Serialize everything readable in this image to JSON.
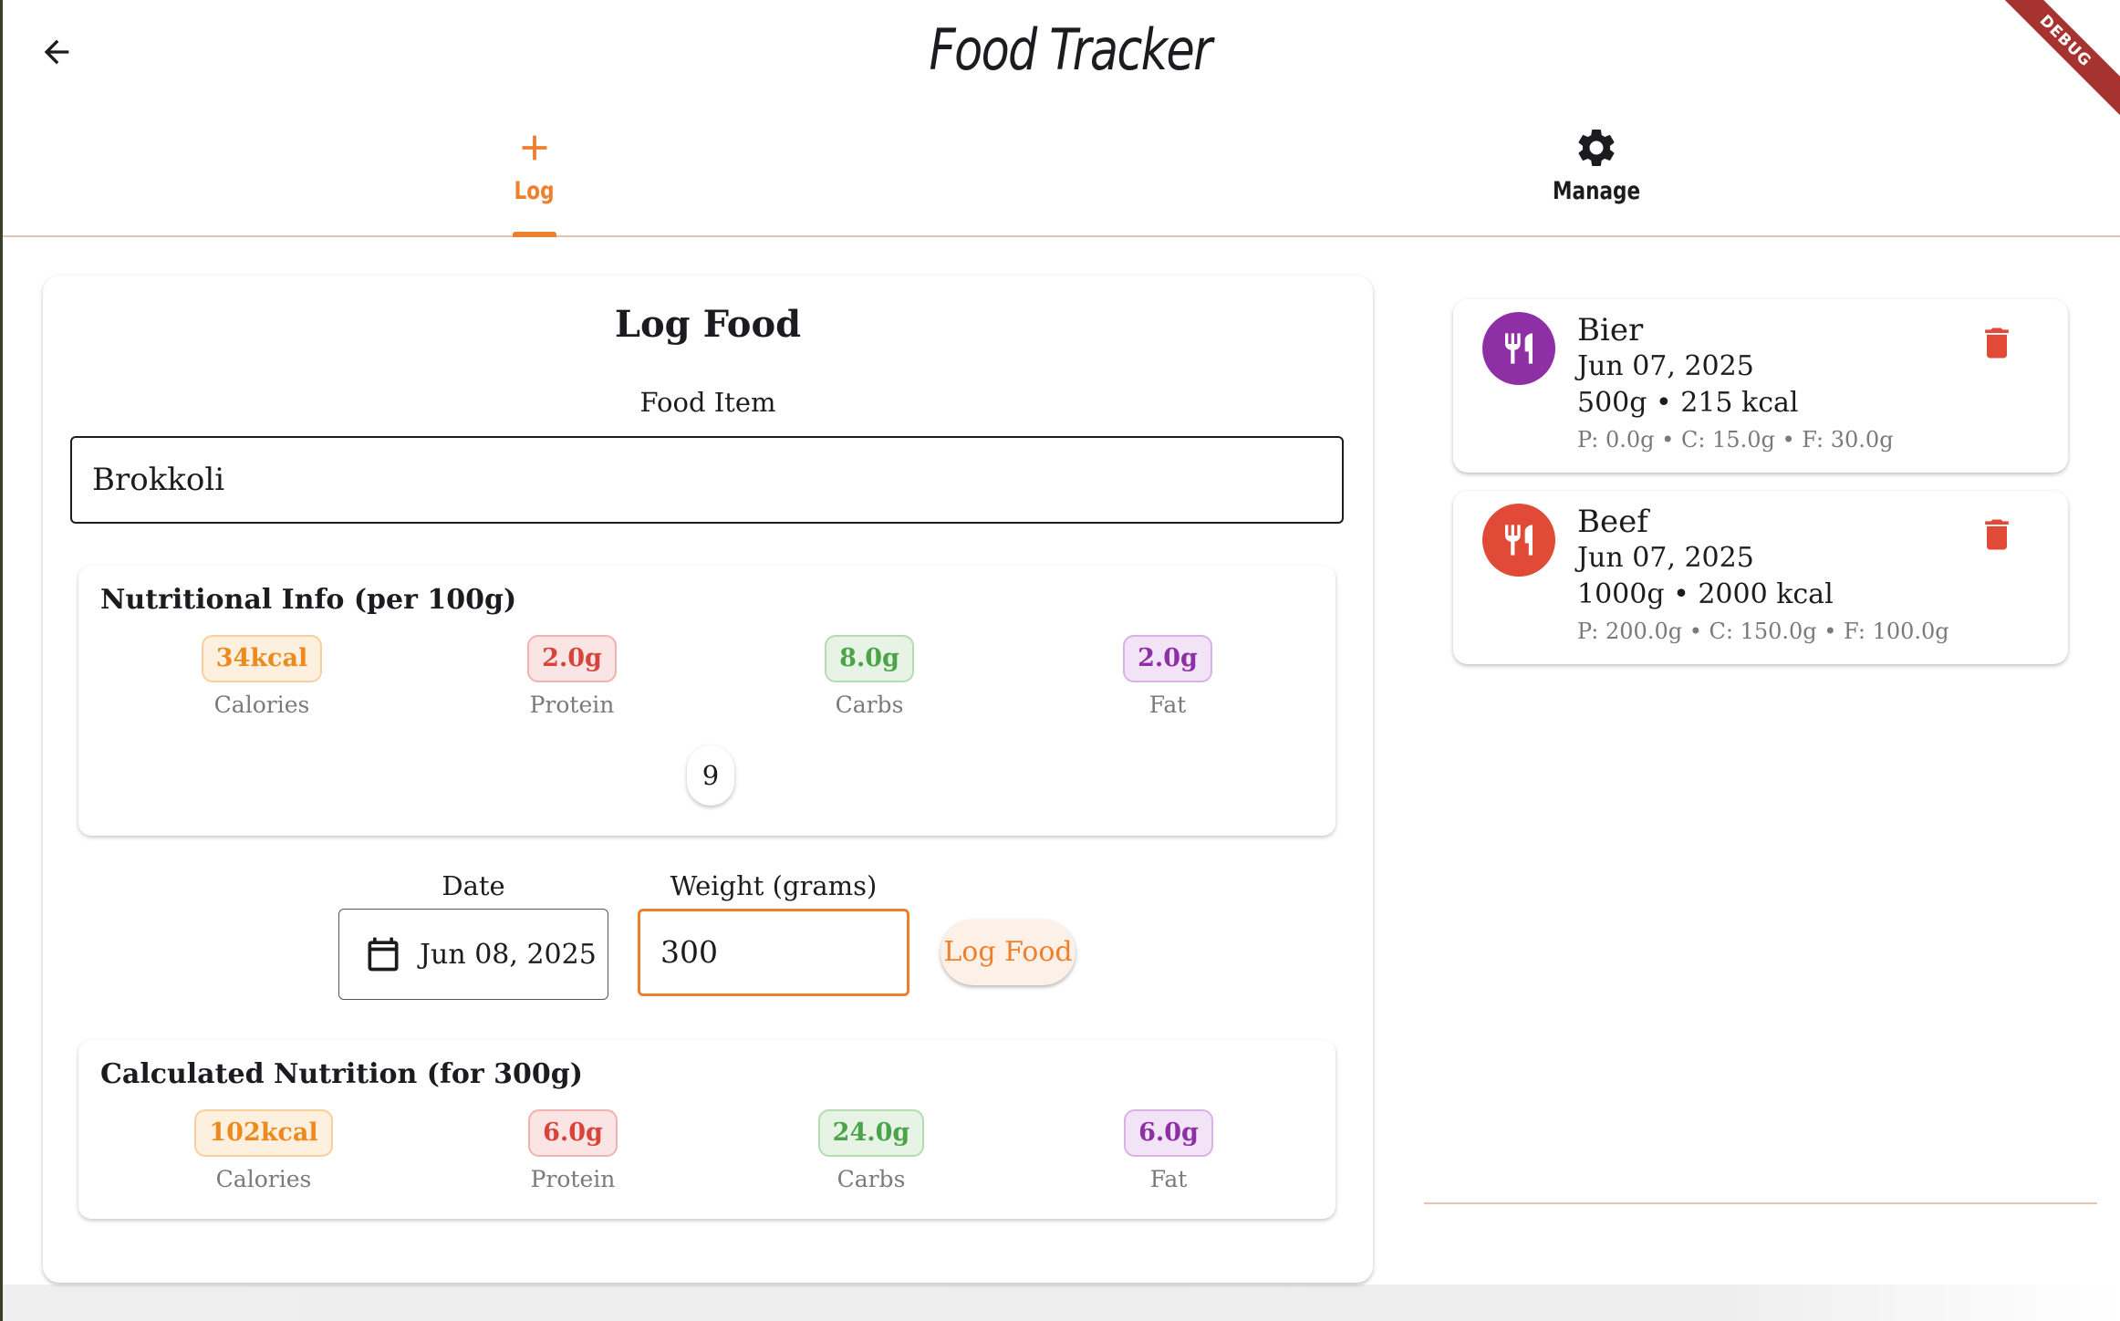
{
  "app": {
    "title": "Food Tracker",
    "debug_banner": "DEBUG"
  },
  "tabs": [
    {
      "label": "Log",
      "icon": "plus-icon",
      "selected": true
    },
    {
      "label": "Manage",
      "icon": "gear-icon",
      "selected": false
    }
  ],
  "log_form": {
    "title": "Log Food",
    "food_item_label": "Food Item",
    "food_item_value": "Brokkoli",
    "per100": {
      "title": "Nutritional Info (per 100g)",
      "calories": "34kcal",
      "protein": "2.0g",
      "carbs": "8.0g",
      "fat": "2.0g",
      "count": "9"
    },
    "labels": {
      "calories": "Calories",
      "protein": "Protein",
      "carbs": "Carbs",
      "fat": "Fat"
    },
    "date_label": "Date",
    "date_value": "Jun 08, 2025",
    "weight_label": "Weight (grams)",
    "weight_value": "300",
    "submit_label": "Log Food",
    "calculated": {
      "title": "Calculated Nutrition (for 300g)",
      "calories": "102kcal",
      "protein": "6.0g",
      "carbs": "24.0g",
      "fat": "6.0g"
    }
  },
  "entries": [
    {
      "name": "Bier",
      "date": "Jun 07, 2025",
      "summary": "500g • 215 kcal",
      "macros": "P: 0.0g • C: 15.0g • F: 30.0g",
      "avatar_color": "#8e2fa6",
      "avatar_icon": "fork-knife-icon"
    },
    {
      "name": "Beef",
      "date": "Jun 07, 2025",
      "summary": "1000g • 2000 kcal",
      "macros": "P: 200.0g • C: 150.0g • F: 100.0g",
      "avatar_color": "#e04a36",
      "avatar_icon": "fork-knife-icon"
    }
  ],
  "colors": {
    "accent": "#ee7f2d",
    "delete": "#e04a36",
    "calories": "#ec8a1e",
    "protein": "#d6443a",
    "carbs": "#4ca44a",
    "fat": "#8d30a6"
  }
}
